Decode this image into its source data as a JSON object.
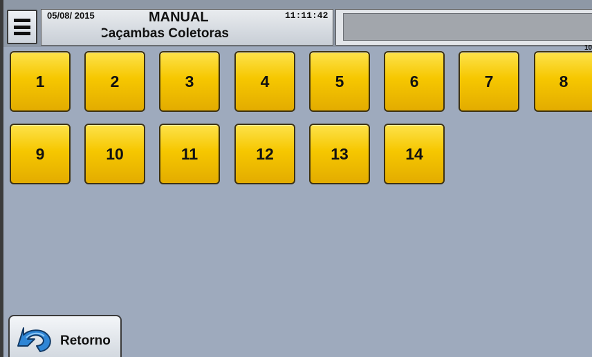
{
  "header": {
    "date": "05/08/ 2015",
    "mode": "MANUAL",
    "time": "11:11:42",
    "screen_title": "Caçambas Coletoras",
    "message": ""
  },
  "page_indicator": "10",
  "buttons": [
    {
      "label": "1"
    },
    {
      "label": "2"
    },
    {
      "label": "3"
    },
    {
      "label": "4"
    },
    {
      "label": "5"
    },
    {
      "label": "6"
    },
    {
      "label": "7"
    },
    {
      "label": "8"
    },
    {
      "label": "9"
    },
    {
      "label": "10"
    },
    {
      "label": "11"
    },
    {
      "label": "12"
    },
    {
      "label": "13"
    },
    {
      "label": "14"
    }
  ],
  "footer": {
    "return_label": "Retorno"
  },
  "colors": {
    "background": "#9eaabd",
    "button_yellow": "#f6c700",
    "return_arrow_blue": "#2f86d6"
  }
}
